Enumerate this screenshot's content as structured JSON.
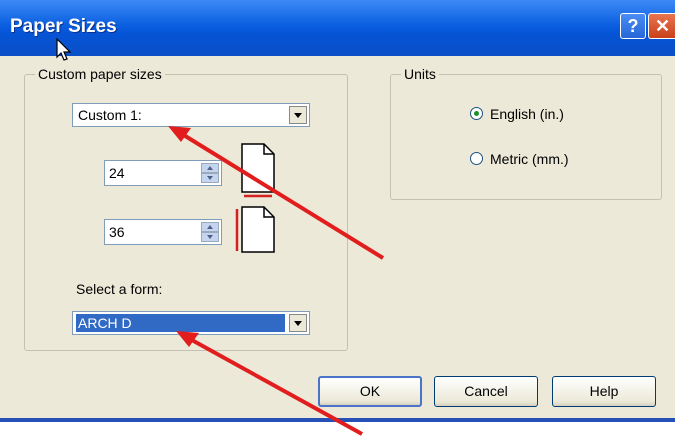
{
  "window": {
    "title": "Paper Sizes",
    "help_label": "?",
    "close_label": "✕"
  },
  "custom_sizes": {
    "group_label": "Custom paper sizes",
    "custom_select_value": "Custom 1:",
    "width_value": "24",
    "height_value": "36",
    "select_form_label": "Select a form:",
    "form_select_value": "ARCH D"
  },
  "units": {
    "group_label": "Units",
    "options": [
      {
        "label": "English (in.)",
        "selected": true
      },
      {
        "label": "Metric (mm.)",
        "selected": false
      }
    ]
  },
  "buttons": {
    "ok": "OK",
    "cancel": "Cancel",
    "help": "Help"
  },
  "colors": {
    "titlebar": "#0554d6",
    "selection": "#316ac5",
    "annotation_arrow": "#e11d1d"
  }
}
